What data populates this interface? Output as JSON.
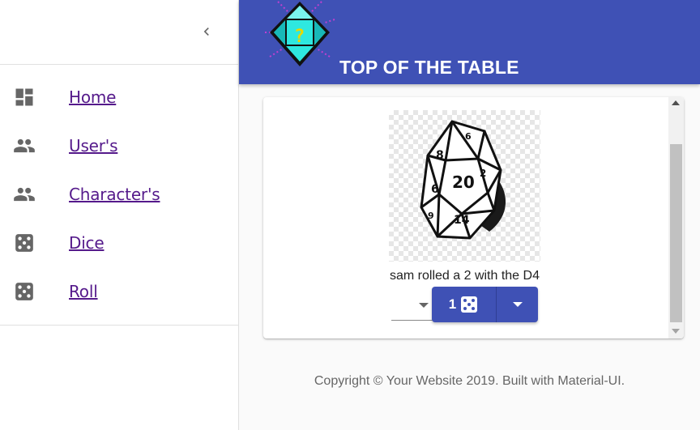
{
  "app": {
    "title": "TOP OF THE TABLE",
    "logo_icon": "d20-pixel-logo-icon",
    "accent_color": "#3f51b5"
  },
  "drawer": {
    "collapse_icon": "chevron-left-icon",
    "items": [
      {
        "label": "Home",
        "icon": "dashboard-icon"
      },
      {
        "label": "User's",
        "icon": "people-icon"
      },
      {
        "label": "Character's",
        "icon": "people-icon"
      },
      {
        "label": "Dice",
        "icon": "dice-five-icon"
      },
      {
        "label": "Roll",
        "icon": "dice-five-icon"
      }
    ]
  },
  "main": {
    "dice_image": "d20-dice-image",
    "roll_result": "sam rolled a 2 with the D4",
    "die_select": {
      "value": ""
    },
    "roll_button": {
      "count": "1",
      "icon": "dice-five-icon"
    },
    "dropdown_icon": "arrow-drop-down-icon"
  },
  "footer": {
    "copyright": "Copyright © Your Website 2019. Built with Material-UI."
  }
}
